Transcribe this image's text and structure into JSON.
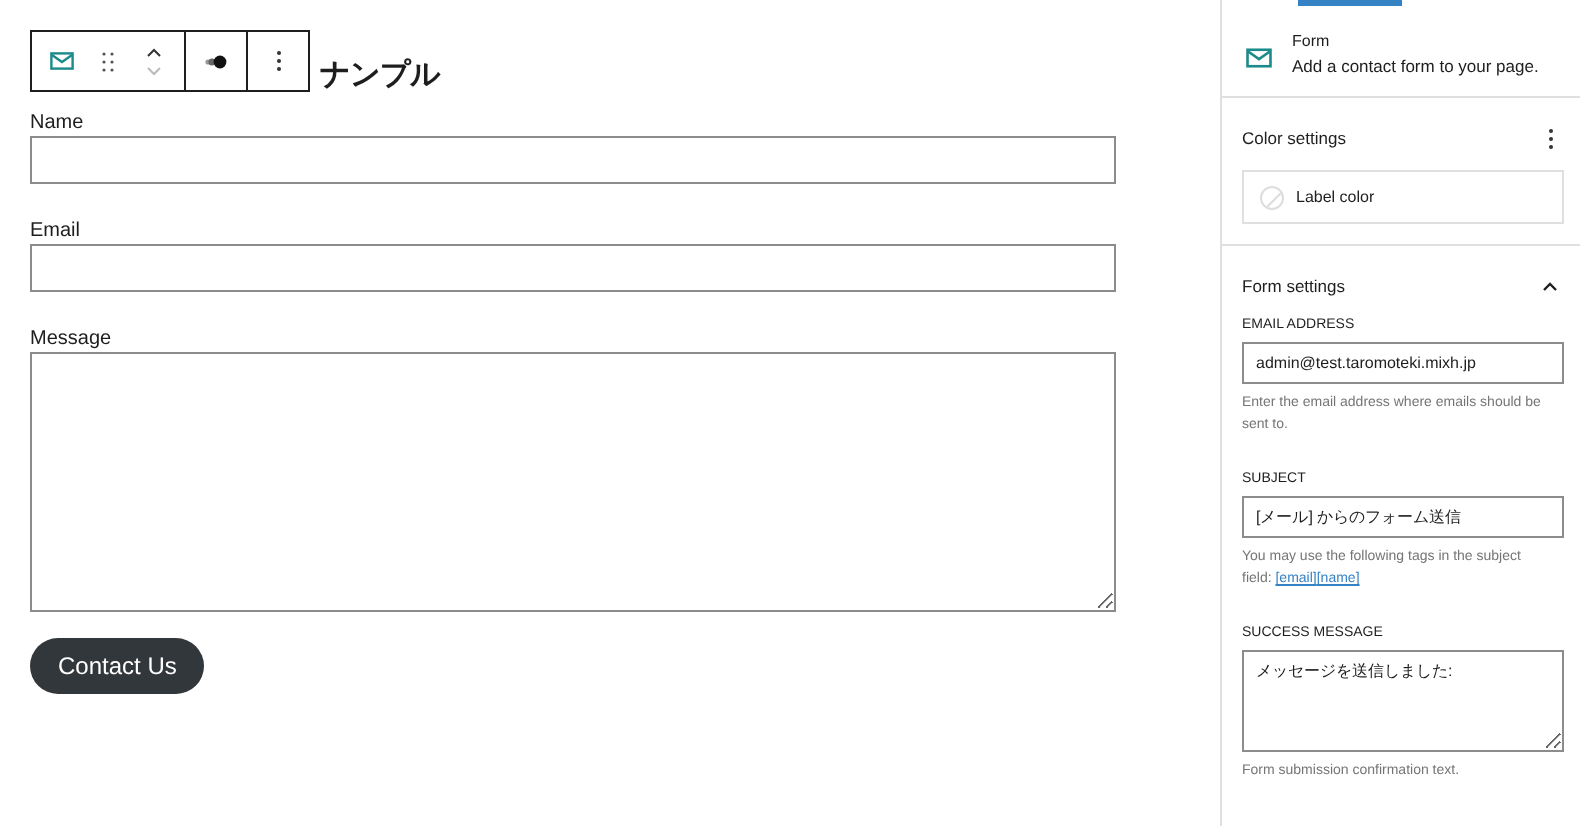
{
  "toolbar": {
    "items": [
      {
        "kind": "block"
      },
      {
        "kind": "drag"
      },
      {
        "kind": "move"
      },
      {
        "kind": "style"
      },
      {
        "kind": "more"
      }
    ]
  },
  "heading": "ナンプル",
  "fields": [
    {
      "label": "Name",
      "kind": "input"
    },
    {
      "label": "Email",
      "kind": "input"
    },
    {
      "label": "Message",
      "kind": "textarea"
    }
  ],
  "submit_button": "Contact Us",
  "sidebar": {
    "block": {
      "title": "Form",
      "description": "Add a contact form to your page."
    },
    "color_settings": {
      "title": "Color settings",
      "items": [
        {
          "label": "Label color"
        }
      ]
    },
    "form_settings": {
      "title": "Form settings",
      "expanded": true,
      "fields": [
        {
          "label": "EMAIL ADDRESS",
          "kind": "input",
          "value": "admin@test.taromoteki.mixh.jp",
          "help": [
            "Enter the email address where emails should be sent to."
          ]
        },
        {
          "label": "SUBJECT",
          "kind": "input",
          "value": "[メール] からのフォーム送信",
          "help": [
            "You may use the following tags in the subject field: ",
            "[email]",
            "[name]"
          ]
        },
        {
          "label": "SUCCESS MESSAGE",
          "kind": "textarea",
          "value": "メッセージを送信しました:",
          "help": [
            "Form submission confirmation text."
          ]
        }
      ]
    }
  }
}
